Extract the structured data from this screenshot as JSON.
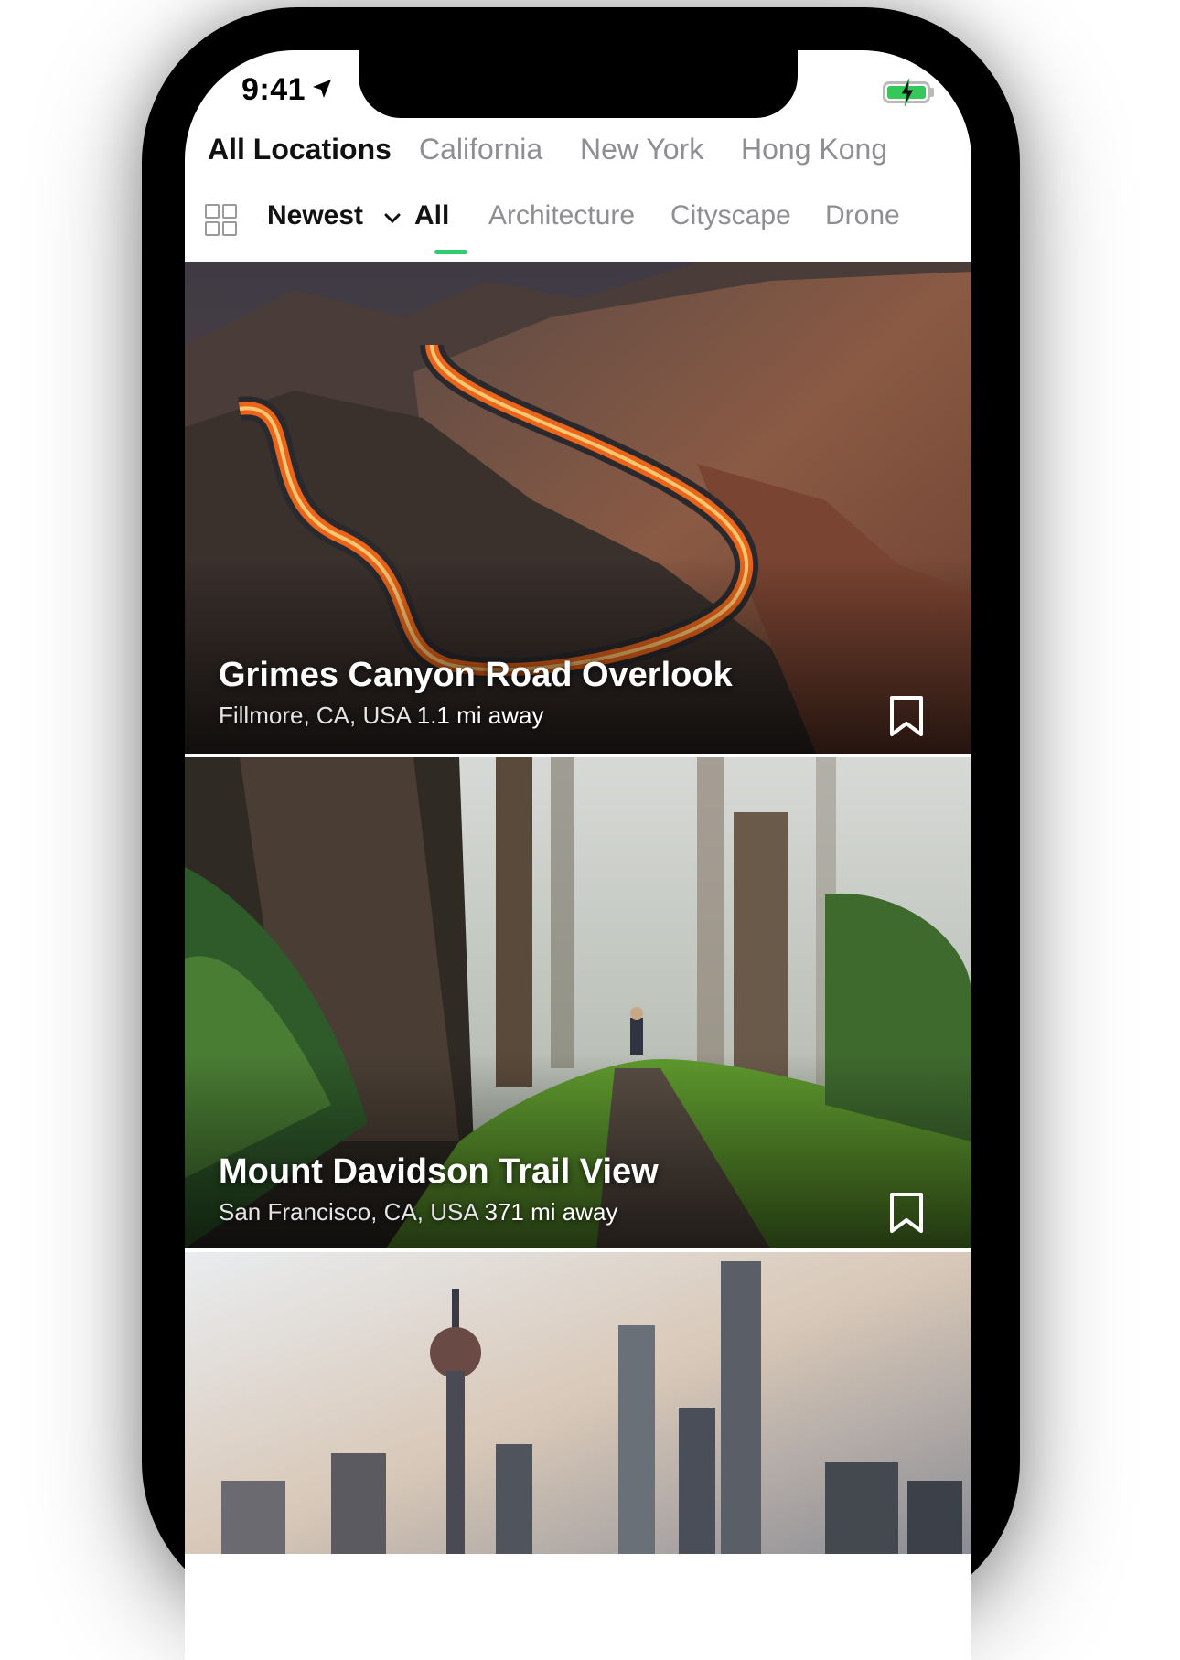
{
  "status_bar": {
    "time": "9:41",
    "location_icon": "location-arrow-icon",
    "battery_icon": "battery-charging-icon"
  },
  "location_tabs": [
    {
      "label": "All Locations",
      "active": true
    },
    {
      "label": "California",
      "active": false
    },
    {
      "label": "New York",
      "active": false
    },
    {
      "label": "Hong Kong",
      "active": false
    }
  ],
  "filter_bar": {
    "view_icon": "grid-icon",
    "sort_label": "Newest",
    "sort_icon": "chevron-down-icon",
    "categories": [
      {
        "label": "All",
        "active": true
      },
      {
        "label": "Architecture",
        "active": false
      },
      {
        "label": "Cityscape",
        "active": false
      },
      {
        "label": "Drone",
        "active": false
      }
    ],
    "accent_color": "#2ecc71"
  },
  "feed": [
    {
      "title": "Grimes Canyon Road Overlook",
      "location": "Fillmore, CA, USA",
      "distance": "1.1 mi away",
      "bookmark_icon": "bookmark-icon"
    },
    {
      "title": "Mount Davidson Trail View",
      "location": "San Francisco, CA, USA",
      "distance": "371 mi away",
      "bookmark_icon": "bookmark-icon"
    },
    {
      "title": "",
      "location": "",
      "distance": "",
      "bookmark_icon": ""
    }
  ]
}
